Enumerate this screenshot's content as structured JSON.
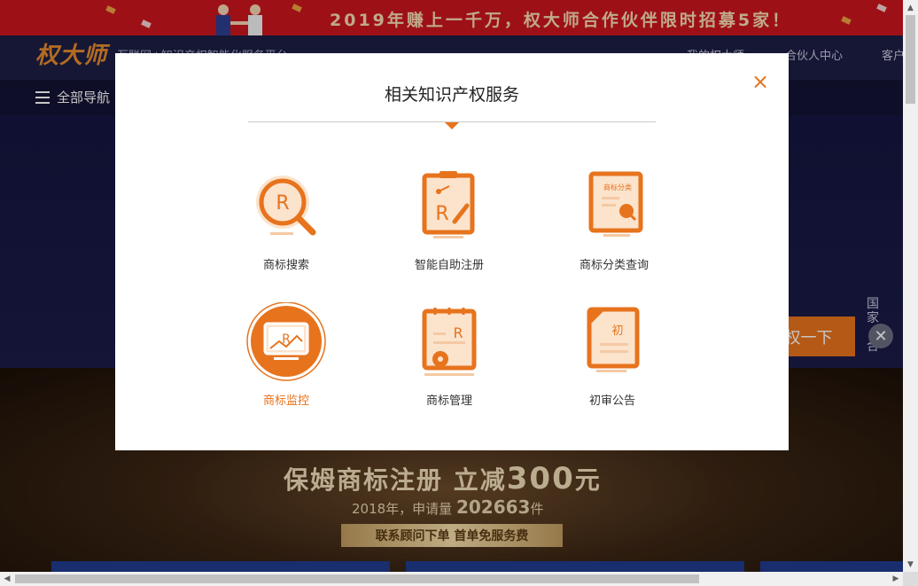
{
  "promo_banner": {
    "text": "2019年赚上一千万，权大师合作伙伴限时招募5家！"
  },
  "header": {
    "logo": "权大师",
    "slogan": "互联网+知识产权智能化服务平台",
    "links": [
      "我的权大师",
      "合伙人中心",
      "客户"
    ]
  },
  "nav": {
    "all_nav_label": "全部导航"
  },
  "hero": {
    "search_button": "权一下",
    "side_tag": "国家\n\n合"
  },
  "promo": {
    "line1_prefix": "保姆商标注册 立减",
    "line1_amount": "300",
    "line1_suffix": "元",
    "line2_prefix": "2018年，申请量 ",
    "line2_count": "202663",
    "line2_suffix": "件",
    "ribbon": "联系顾问下单 首单免服务费"
  },
  "modal": {
    "title": "相关知识产权服务",
    "close_symbol": "×",
    "services": [
      {
        "label": "商标搜索",
        "icon": "trademark-search-icon"
      },
      {
        "label": "智能自助注册",
        "icon": "smart-self-register-icon"
      },
      {
        "label": "商标分类查询",
        "icon": "trademark-class-query-icon",
        "icon_text": "商标分类"
      },
      {
        "label": "商标监控",
        "icon": "trademark-monitor-icon",
        "active": true
      },
      {
        "label": "商标管理",
        "icon": "trademark-management-icon"
      },
      {
        "label": "初审公告",
        "icon": "preliminary-announcement-icon",
        "icon_text": "初"
      }
    ]
  },
  "colors": {
    "accent": "#e7731d",
    "icon_light": "#fbe3cc",
    "banner_red": "#c9171d",
    "header_navy": "#1d1e45"
  }
}
